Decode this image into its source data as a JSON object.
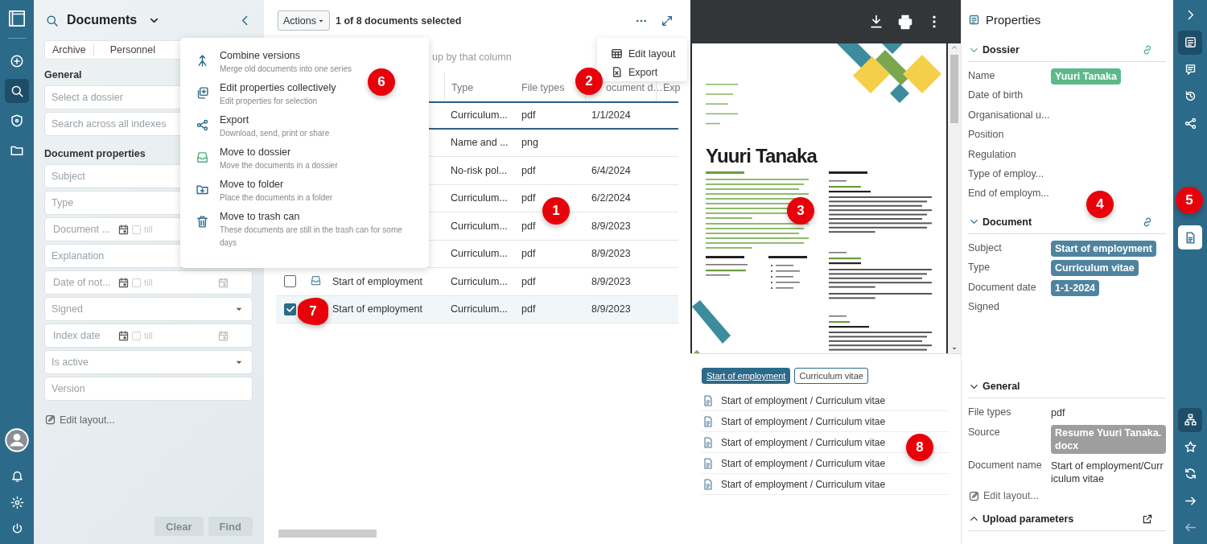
{
  "left_rail": {
    "items": [
      {
        "selected": false
      },
      {
        "selected": true
      },
      {
        "selected": false
      },
      {
        "selected": false
      }
    ]
  },
  "search_panel": {
    "title": "Documents",
    "tabs": [
      {
        "label": "Archive"
      },
      {
        "label": "Personnel"
      }
    ],
    "sections": [
      {
        "heading": "General",
        "fields": [
          {
            "kind": "text",
            "placeholder": "Select a dossier"
          },
          {
            "kind": "text",
            "placeholder": "Search across all indexes"
          }
        ]
      },
      {
        "heading": "Document properties",
        "fields": [
          {
            "kind": "text",
            "placeholder": "Subject"
          },
          {
            "kind": "text",
            "placeholder": "Type"
          },
          {
            "kind": "date",
            "placeholder": "Document ...",
            "checked": false,
            "till": "till"
          },
          {
            "kind": "text",
            "placeholder": "Explanation"
          },
          {
            "kind": "date",
            "placeholder": "Date of not...",
            "checked": false,
            "till": "till",
            "end_calendar": true
          },
          {
            "kind": "select",
            "placeholder": "Signed"
          },
          {
            "kind": "date",
            "placeholder": "Index date",
            "checked": false,
            "till": "till",
            "end_calendar": true
          },
          {
            "kind": "select",
            "placeholder": "Is active"
          },
          {
            "kind": "text",
            "placeholder": "Version"
          }
        ]
      }
    ],
    "edit_layout": "Edit layout...",
    "buttons": [
      {
        "label": "Clear",
        "disabled": true
      },
      {
        "label": "Find",
        "disabled": true
      }
    ]
  },
  "list": {
    "actions_button": "Actions",
    "selection_text": "1 of 8 documents selected",
    "group_hint": "up by that column",
    "columns": [
      {
        "label": "Type"
      },
      {
        "label": "File types"
      },
      {
        "label": "ocument d…"
      },
      {
        "label": "Exp"
      }
    ],
    "rows": [
      {
        "type": "Curriculum...",
        "file_type": "pdf",
        "date": "1/1/2024",
        "current": true
      },
      {
        "type": "Name and ...",
        "file_type": "png",
        "current": false
      },
      {
        "type": "No-risk pol...",
        "file_type": "pdf",
        "date": "6/4/2024",
        "current": false
      },
      {
        "type": "Curriculum...",
        "file_type": "pdf",
        "date": "6/2/2024",
        "current": false
      },
      {
        "type": "Curriculum...",
        "file_type": "pdf",
        "date": "8/9/2023",
        "current": false
      },
      {
        "type": "Curriculum...",
        "file_type": "pdf",
        "date": "8/9/2023",
        "current": false
      },
      {
        "checked": false,
        "dossier_icon": true,
        "title": "Start of employment",
        "type": "Curriculum...",
        "file_type": "pdf",
        "date": "8/9/2023",
        "current": false
      },
      {
        "checked": true,
        "title": "Start of employment",
        "type": "Curriculum...",
        "file_type": "pdf",
        "date": "8/9/2023",
        "current": false
      }
    ]
  },
  "actions_menu": {
    "items": [
      {
        "title": "Combine versions",
        "description": "Merge old documents into one series"
      },
      {
        "title": "Edit properties collectively",
        "description": "Edit properties for selection"
      },
      {
        "title": "Export",
        "description": "Download, send, print or share"
      },
      {
        "title": "Move to dossier",
        "description": "Move the documents in a dossier"
      },
      {
        "title": "Move to folder",
        "description": "Place the documents in a folder"
      },
      {
        "title": "Move to trash can",
        "description": "These documents are still in the trash can for some days"
      }
    ]
  },
  "layout_menu": {
    "items": [
      {
        "label": "Edit layout"
      },
      {
        "label": "Export"
      }
    ]
  },
  "preview": {
    "document": {
      "name": "Yuuri Tanaka"
    },
    "tags": [
      {
        "label": "Start of employment",
        "selected": true
      },
      {
        "label": "Curriculum vitae",
        "selected": false
      }
    ],
    "items": [
      "Start of employment / Curriculum vitae",
      "Start of employment / Curriculum vitae",
      "Start of employment / Curriculum vitae",
      "Start of employment / Curriculum vitae",
      "Start of employment / Curriculum vitae"
    ]
  },
  "properties": {
    "title": "Properties",
    "sections": [
      {
        "title": "Dossier",
        "expanded": true,
        "linked": true,
        "color": "#4caf7d",
        "rows": [
          {
            "label": "Name",
            "value": "Yuuri Tanaka",
            "color": "#5bb98a"
          },
          {
            "label": "Date of birth"
          },
          {
            "label": "Organisational u..."
          },
          {
            "label": "Position"
          },
          {
            "label": "Regulation"
          },
          {
            "label": "Type of employ..."
          },
          {
            "label": "End of employm..."
          }
        ]
      },
      {
        "title": "Document",
        "expanded": true,
        "linked": true,
        "color": "#2d6f91",
        "rows": [
          {
            "label": "Subject",
            "value": "Start of employment",
            "color": "#4f84a0"
          },
          {
            "label": "Type",
            "value": "Curriculum vitae",
            "color": "#4f84a0"
          },
          {
            "label": "Document date",
            "value": "1-1-2024",
            "color": "#4f84a0"
          },
          {
            "label": "Signed"
          }
        ]
      },
      {
        "title": "General",
        "expanded": true,
        "color": "#333333",
        "rows": [
          {
            "label": "File types",
            "value": "pdf"
          },
          {
            "label": "Source",
            "value": "Resume Yuuri Tanaka.docx",
            "color": "#9e9e9e"
          },
          {
            "label": "Document name",
            "value": "Start of employment/Curriculum vitae"
          }
        ]
      },
      {
        "title": "Upload parameters",
        "expanded": false,
        "external": true,
        "color": "#333333"
      }
    ],
    "edit_layout": "Edit layout..."
  },
  "right_rail": {
    "top": [
      {
        "selected": true
      },
      {
        "selected": false
      },
      {
        "selected": false
      },
      {
        "selected": false
      }
    ],
    "middle": [
      {
        "open": true
      }
    ],
    "bottom": [
      {
        "selected": true,
        "disabled": false
      },
      {
        "selected": false,
        "disabled": false
      },
      {
        "selected": false,
        "disabled": false
      },
      {
        "selected": false,
        "disabled": false
      },
      {
        "selected": false,
        "disabled": true
      }
    ]
  },
  "callouts": [
    {
      "label": "1",
      "kind": "circle"
    },
    {
      "label": "2",
      "kind": "circle"
    },
    {
      "label": "3",
      "kind": "circle"
    },
    {
      "label": "4",
      "kind": "circle"
    },
    {
      "label": "5",
      "kind": "circle"
    },
    {
      "label": "6",
      "kind": "circle"
    },
    {
      "label": "7",
      "kind": "pointer"
    },
    {
      "label": "8",
      "kind": "circle"
    }
  ]
}
